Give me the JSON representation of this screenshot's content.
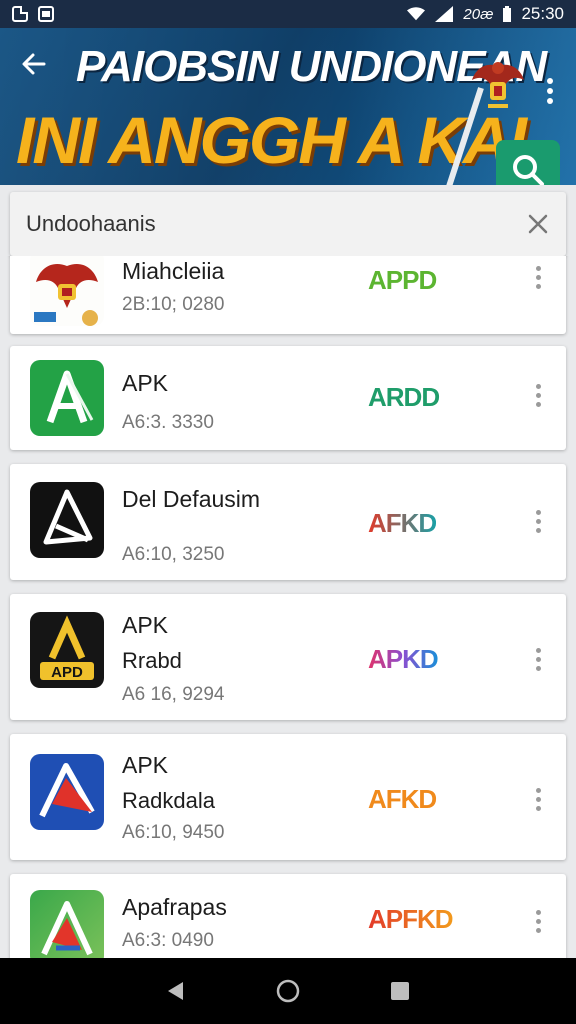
{
  "status_bar": {
    "carrier": "20æ",
    "time": "25:30"
  },
  "header": {
    "title_line1": "PAIOBSIN UNDIONEAN",
    "title_line2": "INI ANGGH A KAL"
  },
  "search": {
    "value": "Undoohaanis"
  },
  "apps": [
    {
      "name": "Miahcleiia",
      "sub": "",
      "meta": "2B:10; 0280",
      "badge": "APPD"
    },
    {
      "name": "APK",
      "sub": "",
      "meta": "A6:3. 3330",
      "badge": "ARDD"
    },
    {
      "name": "Del Defausim",
      "sub": "",
      "meta": "A6:10, 3250",
      "badge": "AFKD"
    },
    {
      "name": "APK",
      "sub": "Rrabd",
      "meta": "A6 16, 9294",
      "badge": "APKD"
    },
    {
      "name": "APK",
      "sub": "Radkdala",
      "meta": "A6:10, 9450",
      "badge": "AFKD"
    },
    {
      "name": "Apafrapas",
      "sub": "",
      "meta": "A6:3: 0490",
      "badge": "APFKD"
    }
  ],
  "icons": {
    "back": "arrow-left-icon",
    "more": "more-vert-icon",
    "search": "search-icon",
    "clear": "close-icon",
    "nav_back": "triangle-back-icon",
    "nav_home": "circle-home-icon",
    "nav_recent": "square-recent-icon"
  },
  "colors": {
    "header_bg": "#0e3d66",
    "title_accent": "#f6b21c",
    "search_button": "#1a9b6e",
    "badge_green": "#3aa33a",
    "badge_teal": "#1f9d6a",
    "badge_orange": "#f08a1c"
  }
}
